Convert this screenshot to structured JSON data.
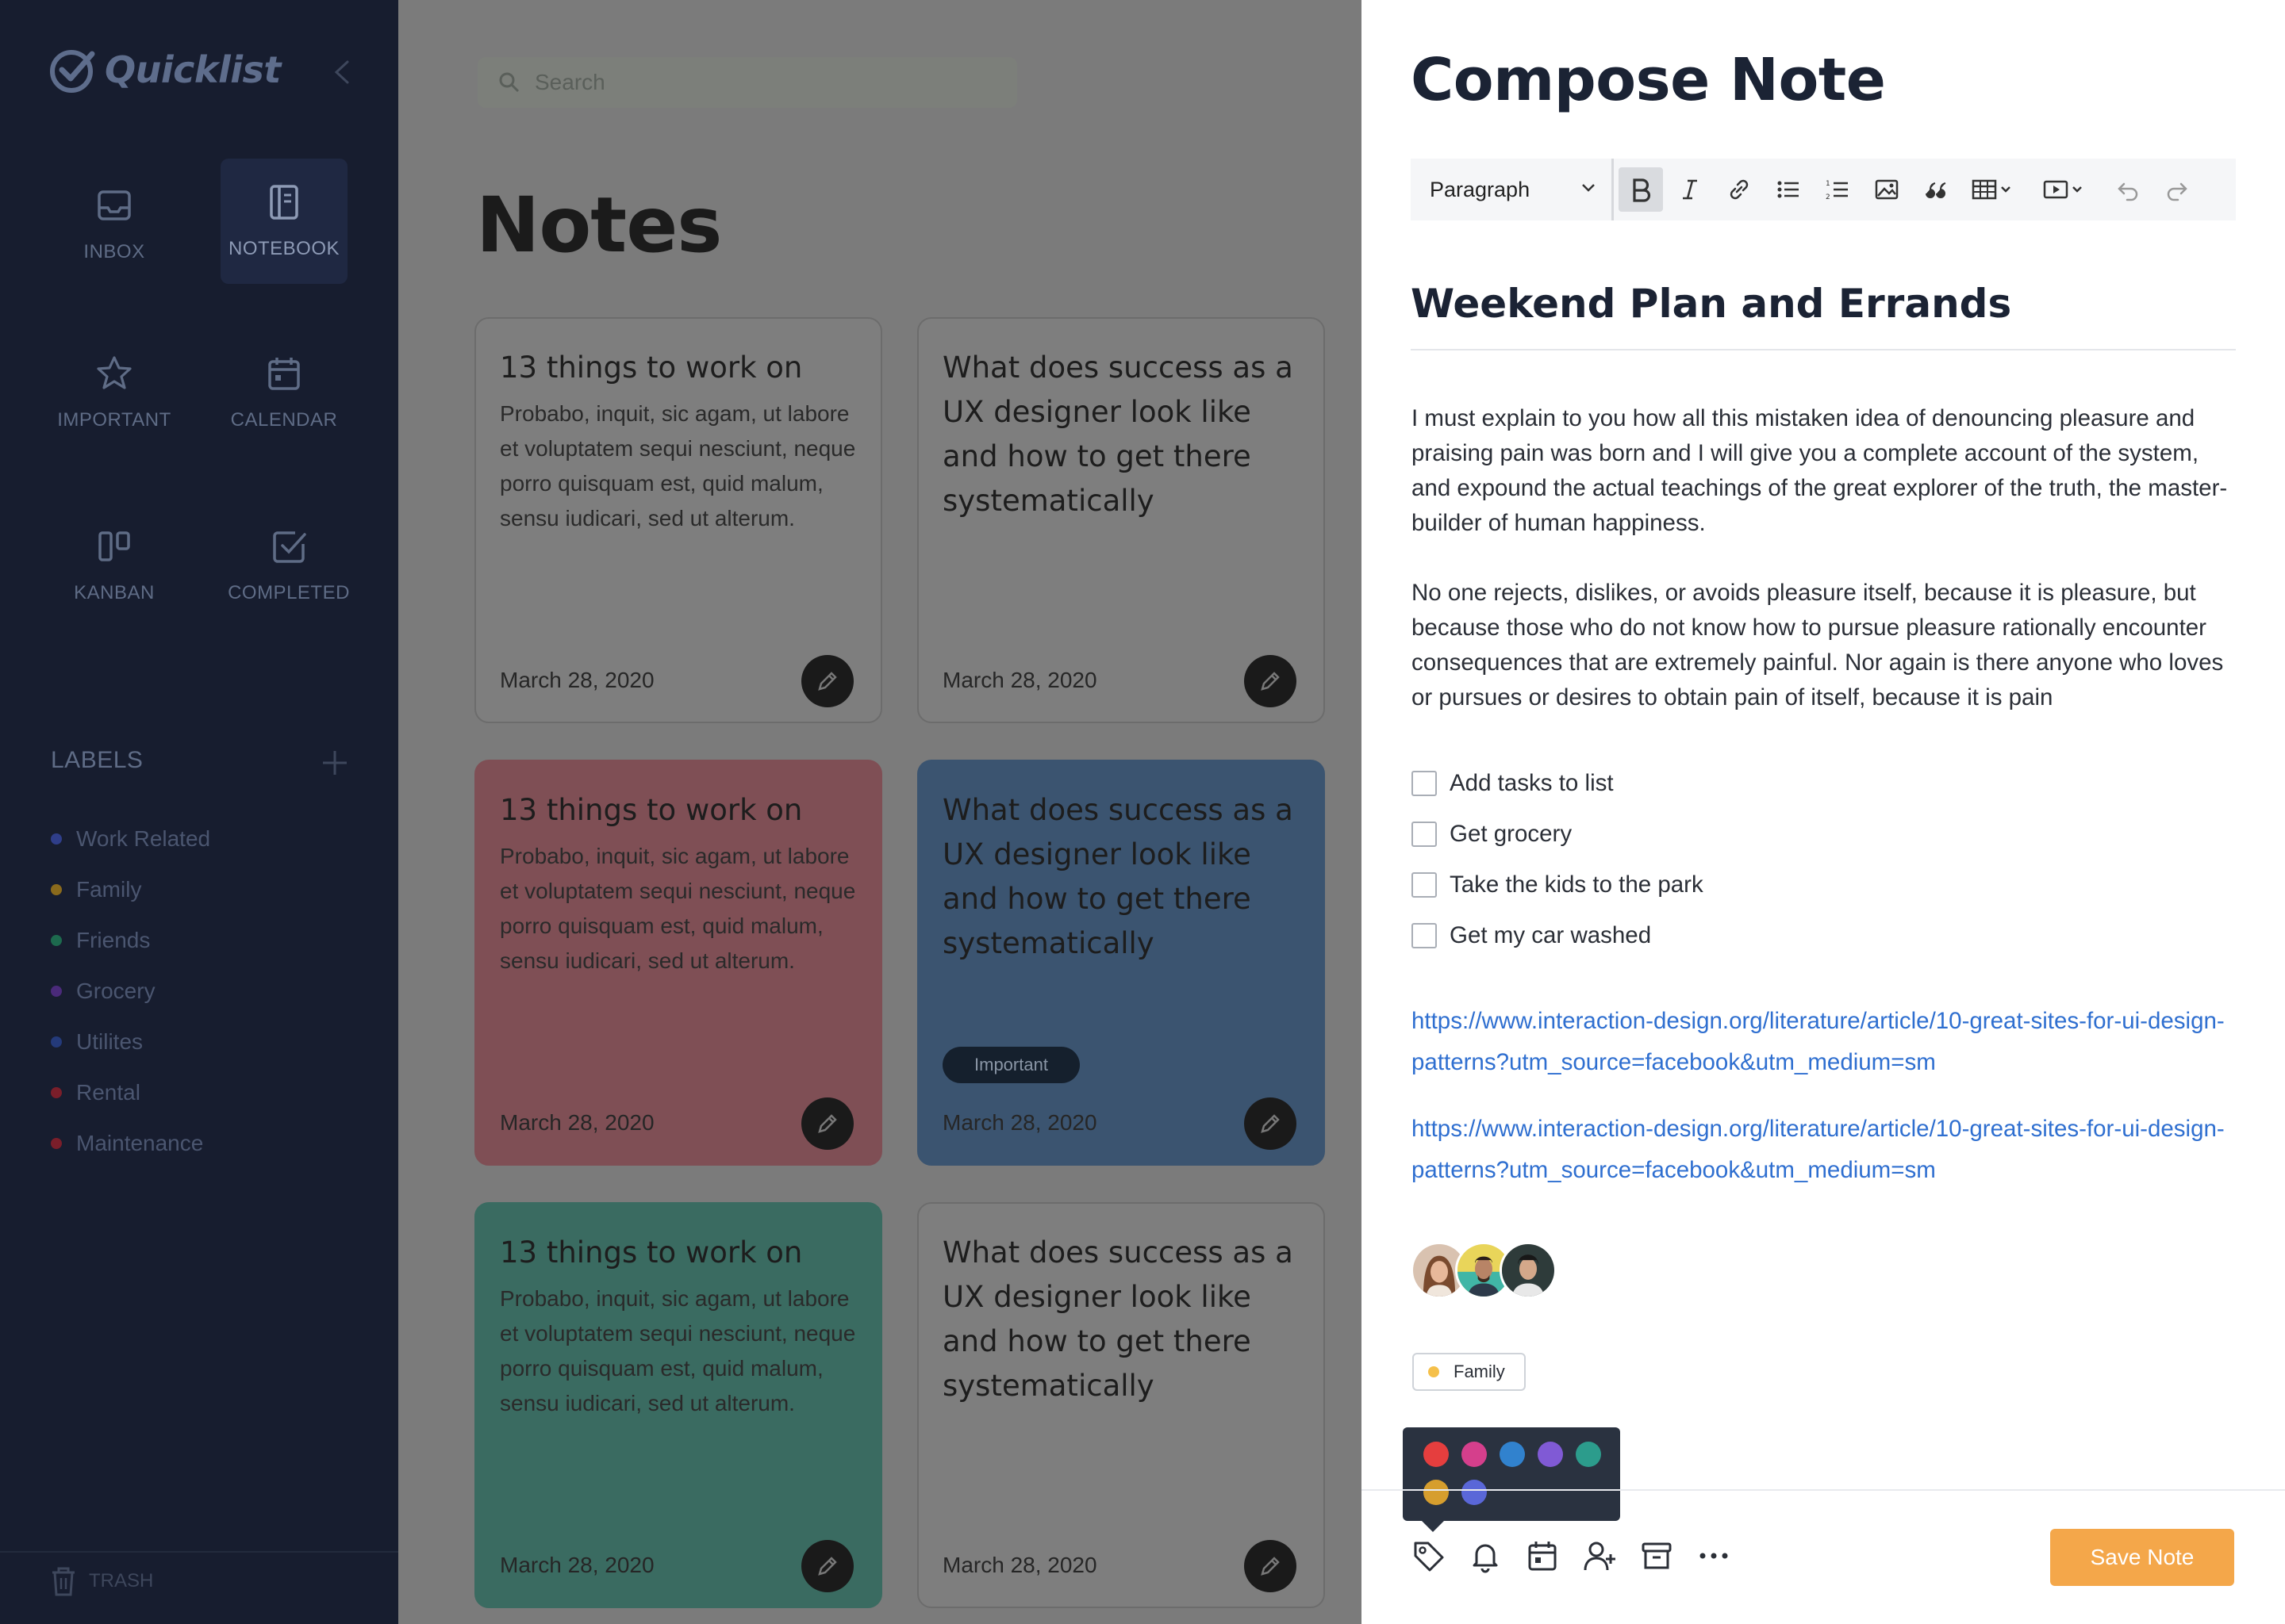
{
  "app": {
    "name": "Quicklist"
  },
  "sidebar": {
    "nav": [
      {
        "label": "INBOX",
        "icon": "inbox-icon"
      },
      {
        "label": "NOTEBOOK",
        "icon": "notebook-icon",
        "active": true
      },
      {
        "label": "IMPORTANT",
        "icon": "star-icon"
      },
      {
        "label": "CALENDAR",
        "icon": "calendar-icon"
      },
      {
        "label": "KANBAN",
        "icon": "kanban-icon"
      },
      {
        "label": "COMPLETED",
        "icon": "check-square-icon"
      }
    ],
    "labels_heading": "LABELS",
    "labels": [
      {
        "name": "Work Related",
        "color": "#2f3e8a"
      },
      {
        "name": "Family",
        "color": "#8a6a1c"
      },
      {
        "name": "Friends",
        "color": "#1d6a4e"
      },
      {
        "name": "Grocery",
        "color": "#4a2a7a"
      },
      {
        "name": "Utilites",
        "color": "#243a7a"
      },
      {
        "name": "Rental",
        "color": "#7a1e2a"
      },
      {
        "name": "Maintenance",
        "color": "#7a1e2a"
      }
    ],
    "trash_label": "TRASH"
  },
  "main": {
    "search_placeholder": "Search",
    "title": "Notes",
    "cards": [
      {
        "title": "13 things to work on",
        "body": "Probabo, inquit, sic agam, ut labore et voluptatem sequi nesciunt, neque porro quisquam est, quid malum, sensu iudicari, sed ut alterum.",
        "date": "March 28, 2020",
        "color": "default"
      },
      {
        "title": "What does success as a UX designer look like and how to get there systematically",
        "body": "",
        "date": "March 28, 2020",
        "color": "default"
      },
      {
        "title": "13 things to work on",
        "body": "Probabo, inquit, sic agam, ut labore et voluptatem sequi nesciunt, neque porro quisquam est, quid malum, sensu iudicari, sed ut alterum.",
        "date": "March 28, 2020",
        "color": "red"
      },
      {
        "title": "What does success as a UX designer look like and how to get there systematically",
        "body": "",
        "date": "March 28, 2020",
        "color": "blue",
        "badge": "Important"
      },
      {
        "title": "13 things to work on",
        "body": "Probabo, inquit, sic agam, ut labore et voluptatem sequi nesciunt, neque porro quisquam est, quid malum, sensu iudicari, sed ut alterum.",
        "date": "March 28, 2020",
        "color": "green"
      },
      {
        "title": "What does success as a UX designer look like and how to get there systematically",
        "body": "",
        "date": "March 28, 2020",
        "color": "default"
      }
    ]
  },
  "compose": {
    "title": "Compose Note",
    "toolbar": {
      "block_format": "Paragraph",
      "buttons": [
        "bold-icon",
        "italic-icon",
        "link-icon",
        "bulleted-list-icon",
        "numbered-list-icon",
        "image-icon",
        "blockquote-icon",
        "table-icon",
        "media-icon",
        "undo-icon",
        "redo-icon"
      ]
    },
    "note_title": "Weekend Plan and Errands",
    "paragraphs": [
      "I must explain to you how all this mistaken idea of denouncing pleasure and praising pain was born and I will give you a complete account of the system, and expound the actual teachings of the great explorer of the truth, the master-builder of human happiness.",
      "No one rejects, dislikes, or avoids pleasure itself, because it is pleasure, but because those who do not know how to pursue pleasure rationally encounter consequences that are extremely painful. Nor again is there anyone who loves or pursues or desires to obtain pain of itself, because it is pain"
    ],
    "checklist": [
      {
        "label": "Add tasks to list",
        "checked": false
      },
      {
        "label": "Get grocery",
        "checked": false
      },
      {
        "label": "Take the kids to the park",
        "checked": false
      },
      {
        "label": "Get my car washed",
        "checked": false
      }
    ],
    "links": [
      "https://www.interaction-design.org/literature/article/10-great-sites-for-ui-design-patterns?utm_source=facebook&utm_medium=sm",
      "https://www.interaction-design.org/literature/article/10-great-sites-for-ui-design-patterns?utm_source=facebook&utm_medium=sm"
    ],
    "collaborators": 3,
    "tag": {
      "name": "Family",
      "color": "#f5c04a"
    },
    "palette_colors": [
      "#e53e3e",
      "#d53f8c",
      "#3182ce",
      "#805ad5",
      "#2c9c8c",
      "#d69e2e",
      "#5a67d8"
    ],
    "footer_icons": [
      "tag-icon",
      "bell-icon",
      "calendar-icon",
      "add-user-icon",
      "archive-icon",
      "more-icon"
    ],
    "save_label": "Save Note"
  }
}
